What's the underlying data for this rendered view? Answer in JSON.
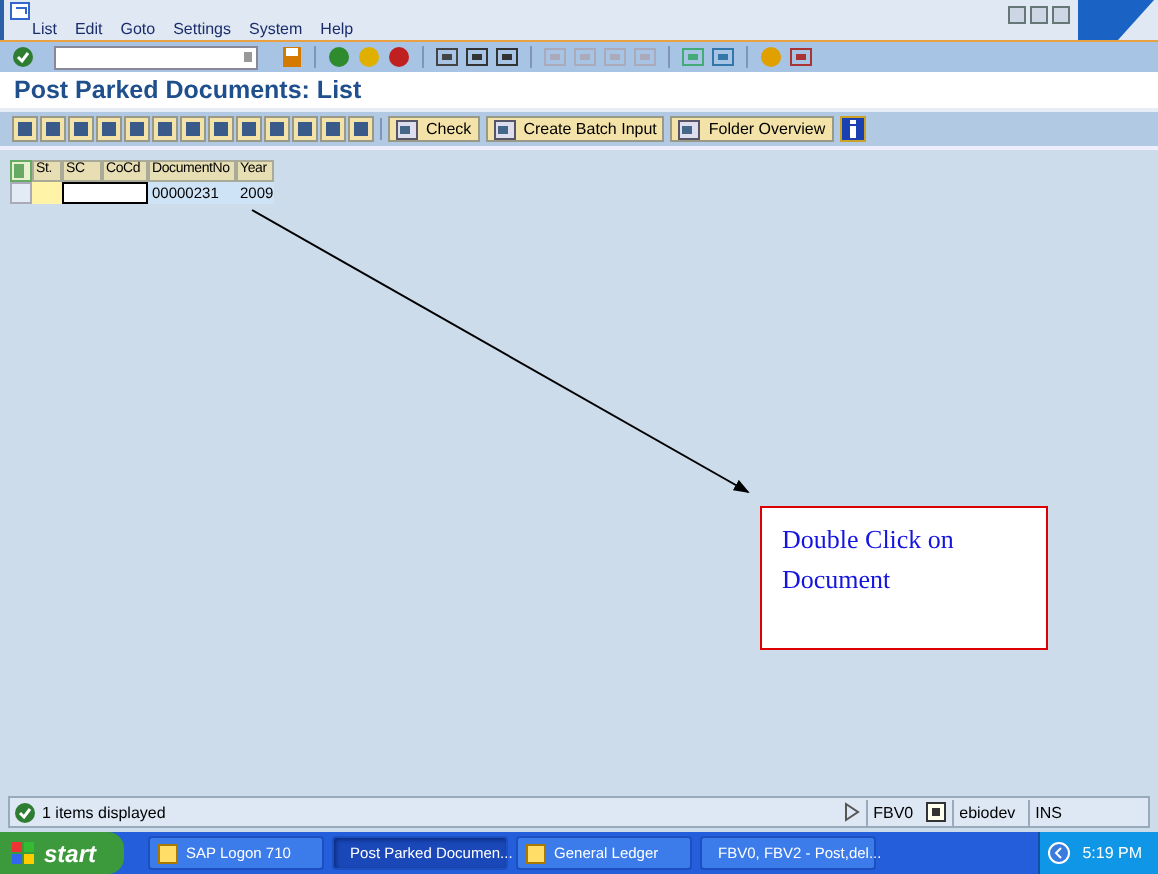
{
  "menu": [
    "List",
    "Edit",
    "Goto",
    "Settings",
    "System",
    "Help"
  ],
  "title": "Post Parked Documents: List",
  "app_toolbar": {
    "buttons": [
      {
        "label": "Check"
      },
      {
        "label": "Create Batch Input"
      },
      {
        "label": "Folder Overview"
      }
    ]
  },
  "table": {
    "columns": [
      "St.",
      "SC",
      "CoCd",
      "DocumentNo",
      "Year"
    ],
    "rows": [
      {
        "document_no": "00000231",
        "year": "2009"
      }
    ]
  },
  "annotation": {
    "text": "Double Click on Document"
  },
  "status_bar": {
    "message": "1 items displayed",
    "transaction": "FBV0",
    "user": "ebiodev",
    "mode": "INS"
  },
  "taskbar": {
    "start": "start",
    "clock": "5:19 PM",
    "tasks": [
      {
        "label": "SAP Logon 710",
        "selected": false
      },
      {
        "label": "Post Parked Documen...",
        "selected": true
      },
      {
        "label": "General Ledger",
        "selected": false
      },
      {
        "label": "FBV0, FBV2 - Post,del...",
        "selected": false
      }
    ]
  }
}
